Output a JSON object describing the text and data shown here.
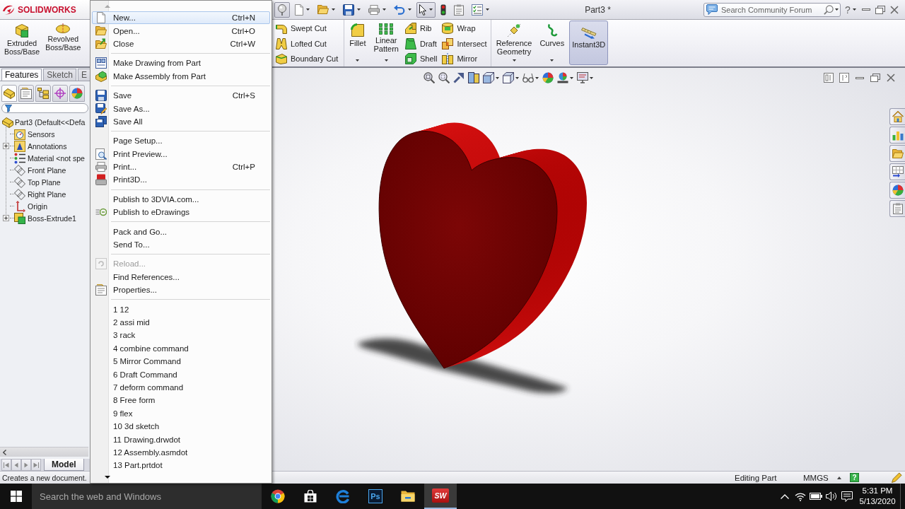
{
  "title_bar": {
    "logo": "SOLIDWORKS",
    "quick_access": [
      {
        "pressed": true,
        "dropdown": false
      },
      {
        "pressed": false,
        "dropdown": true
      },
      {
        "pressed": false,
        "dropdown": true
      },
      {
        "pressed": false,
        "dropdown": true
      },
      {
        "pressed": false,
        "dropdown": true
      },
      {
        "pressed": false,
        "dropdown": true
      },
      {
        "pressed": true,
        "dropdown": true
      },
      {
        "pressed": false,
        "dropdown": false
      },
      {
        "pressed": false,
        "dropdown": false
      },
      {
        "pressed": false,
        "dropdown": true
      }
    ],
    "document_title": "Part3 *",
    "search": {
      "placeholder": "Search Community Forum"
    },
    "help_button": "?"
  },
  "ribbon": {
    "start_tools": [
      {
        "label": "Extruded Boss/Base",
        "dropdown": false,
        "on": false
      },
      {
        "label": "Revolved Boss/Base",
        "dropdown": false,
        "on": false
      }
    ],
    "sections": [
      [
        {
          "kind": "stack",
          "tools": [
            {
              "label": "Swept Cut"
            },
            {
              "label": "Lofted Cut"
            },
            {
              "label": "Boundary Cut"
            }
          ]
        }
      ],
      [
        {
          "kind": "large",
          "label": "Fillet",
          "dropdown": true,
          "on": false
        },
        {
          "kind": "large",
          "label": "Linear Pattern",
          "dropdown": true,
          "on": false
        },
        {
          "kind": "stack",
          "tools": [
            {
              "label": "Rib"
            },
            {
              "label": "Draft"
            },
            {
              "label": "Shell"
            }
          ]
        },
        {
          "kind": "stack",
          "tools": [
            {
              "label": "Wrap"
            },
            {
              "label": "Intersect"
            },
            {
              "label": "Mirror"
            }
          ]
        }
      ],
      [
        {
          "kind": "large",
          "label": "Reference Geometry",
          "dropdown": true,
          "on": false
        },
        {
          "kind": "large",
          "label": "Curves",
          "dropdown": true,
          "on": false
        },
        {
          "kind": "large",
          "label": "Instant3D",
          "dropdown": false,
          "on": true
        }
      ]
    ]
  },
  "file_menu": {
    "sections": [
      [
        {
          "label": "New...",
          "shortcut": "Ctrl+N",
          "selected": true,
          "disabled": false
        },
        {
          "label": "Open...",
          "shortcut": "Ctrl+O",
          "selected": false,
          "disabled": false
        },
        {
          "label": "Close",
          "shortcut": "Ctrl+W",
          "selected": false,
          "disabled": false
        }
      ],
      [
        {
          "label": "Make Drawing from Part",
          "selected": false,
          "disabled": false
        },
        {
          "label": "Make Assembly from Part",
          "selected": false,
          "disabled": false
        }
      ],
      [
        {
          "label": "Save",
          "shortcut": "Ctrl+S",
          "selected": false,
          "disabled": false
        },
        {
          "label": "Save As...",
          "selected": false,
          "disabled": false
        },
        {
          "label": "Save All",
          "selected": false,
          "disabled": false
        }
      ],
      [
        {
          "label": "Page Setup...",
          "selected": false,
          "disabled": false
        },
        {
          "label": "Print Preview...",
          "selected": false,
          "disabled": false
        },
        {
          "label": "Print...",
          "shortcut": "Ctrl+P",
          "selected": false,
          "disabled": false
        },
        {
          "label": "Print3D...",
          "selected": false,
          "disabled": false
        }
      ],
      [
        {
          "label": "Publish to 3DVIA.com...",
          "selected": false,
          "disabled": false
        },
        {
          "label": "Publish to eDrawings",
          "selected": false,
          "disabled": false
        }
      ],
      [
        {
          "label": "Pack and Go...",
          "selected": false,
          "disabled": false
        },
        {
          "label": "Send To...",
          "selected": false,
          "disabled": false
        }
      ],
      [
        {
          "label": "Reload...",
          "selected": false,
          "disabled": true
        },
        {
          "label": "Find References...",
          "selected": false,
          "disabled": false
        },
        {
          "label": "Properties...",
          "selected": false,
          "disabled": false
        }
      ],
      [
        {
          "label": "1 12",
          "selected": false,
          "disabled": false
        },
        {
          "label": "2 assi mid",
          "selected": false,
          "disabled": false
        },
        {
          "label": "3 rack",
          "selected": false,
          "disabled": false
        },
        {
          "label": "4 combine command",
          "selected": false,
          "disabled": false
        },
        {
          "label": "5 Mirror Command",
          "selected": false,
          "disabled": false
        },
        {
          "label": "6 Draft Command",
          "selected": false,
          "disabled": false
        },
        {
          "label": "7 deform command",
          "selected": false,
          "disabled": false
        },
        {
          "label": "8 Free form",
          "selected": false,
          "disabled": false
        },
        {
          "label": "9 flex",
          "selected": false,
          "disabled": false
        },
        {
          "label": "10 3d sketch",
          "selected": false,
          "disabled": false
        },
        {
          "label": "11 Drawing.drwdot",
          "selected": false,
          "disabled": false
        },
        {
          "label": "12 Assembly.asmdot",
          "selected": false,
          "disabled": false
        },
        {
          "label": "13 Part.prtdot",
          "selected": false,
          "disabled": false
        }
      ]
    ]
  },
  "tabs": [
    {
      "label": "Features",
      "selected": true
    },
    {
      "label": "Sketch",
      "selected": false
    },
    {
      "label": "E",
      "selected": false
    }
  ],
  "manager_tabs": [
    {
      "selected": true
    },
    {
      "selected": false
    },
    {
      "selected": false
    },
    {
      "selected": false
    },
    {
      "selected": false
    }
  ],
  "feature_tree": {
    "root": {
      "label": "Part3 (Default<<Defa",
      "kind": "part",
      "children": [
        {
          "label": "Sensors",
          "kind": "sensors",
          "collapsed": false
        },
        {
          "label": "Annotations",
          "kind": "annotations",
          "collapsed": true
        },
        {
          "label": "Material <not spe",
          "kind": "material",
          "collapsed": false
        },
        {
          "label": "Front Plane",
          "kind": "plane",
          "collapsed": false
        },
        {
          "label": "Top Plane",
          "kind": "plane",
          "collapsed": false
        },
        {
          "label": "Right Plane",
          "kind": "plane",
          "collapsed": false
        },
        {
          "label": "Origin",
          "kind": "origin",
          "collapsed": false
        },
        {
          "label": "Boss-Extrude1",
          "kind": "feature",
          "collapsed": true
        }
      ]
    }
  },
  "bottom_tabs": [
    {
      "label": "Model",
      "selected": true
    }
  ],
  "status_bar": {
    "message": "Creates a new document.",
    "mode": "Editing Part",
    "units": "MMGS",
    "tips_button": "?"
  },
  "taskbar": {
    "search": {
      "placeholder": "Search the web and Windows"
    },
    "apps": [
      {
        "kind": "wheel",
        "active": false
      },
      {
        "kind": "bag",
        "active": false
      },
      {
        "kind": "swirl",
        "active": false
      },
      {
        "kind": "tile",
        "label": "Ps",
        "active": false
      },
      {
        "kind": "folder",
        "active": false
      },
      {
        "kind": "badge",
        "label": "SW",
        "active": true
      }
    ],
    "clock": {
      "time": "5:31 PM",
      "date": "5/13/2020"
    }
  }
}
